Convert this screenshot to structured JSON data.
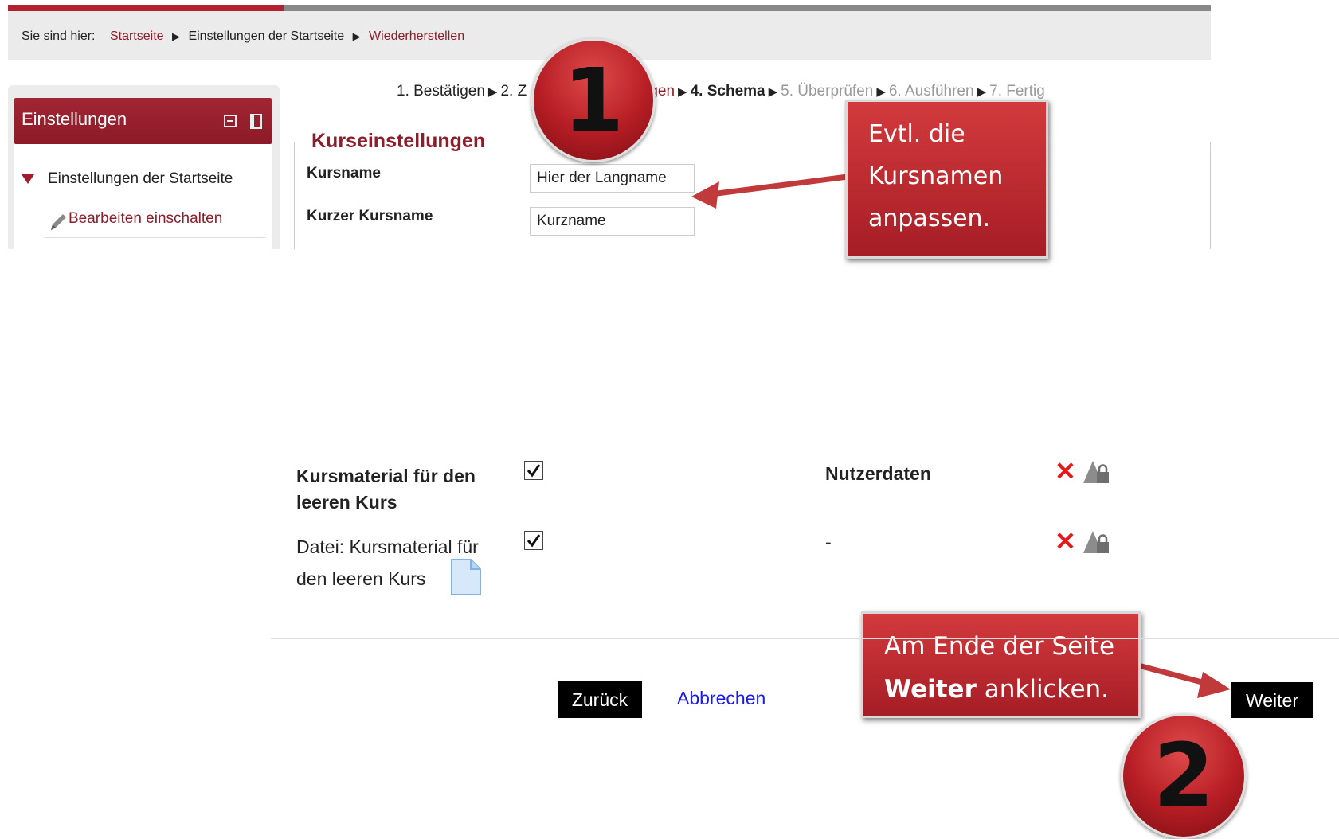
{
  "breadcrumb": {
    "lead": "Sie sind hier:",
    "items": [
      "Startseite",
      "Einstellungen der Startseite",
      "Wiederherstellen"
    ]
  },
  "sidebar": {
    "title": "Einstellungen",
    "items": [
      {
        "label": "Einstellungen der Startseite",
        "icon": "triangle-down-icon"
      },
      {
        "label": "Bearbeiten einschalten",
        "icon": "pencil-icon"
      }
    ]
  },
  "steps": {
    "s1": "1. Bestätigen",
    "s2": "2. Z",
    "s3": "ungen",
    "s4": "4. Schema",
    "s5": "5. Überprüfen",
    "s6": "6. Ausführen",
    "s7": "7. Fertig",
    "arrow": "▶"
  },
  "form": {
    "legend": "Kurseinstellungen",
    "fullname_label": "Kursname",
    "fullname_value": "Hier der Langname",
    "shortname_label": "Kurzer Kursname",
    "shortname_value": "Kurzname"
  },
  "callouts": {
    "c1": [
      "Evtl. die",
      "Kursnamen",
      "anpassen."
    ],
    "c2_line1": "Am Ende der Seite",
    "c2_bold": "Weiter",
    "c2_rest": " anklicken."
  },
  "badges": {
    "b1": "1",
    "b2": "2"
  },
  "schema": {
    "section_title": "Kursmaterial für den leeren Kurs",
    "section_userdata": "Nutzerdaten",
    "file_label": "Datei: Kursmaterial für den leeren Kurs",
    "file_userdata": "-"
  },
  "buttons": {
    "back": "Zurück",
    "cancel": "Abbrechen",
    "next": "Weiter"
  },
  "colors": {
    "brand": "#8a1e2a",
    "callout": "#b9262f",
    "link": "#1a1aee"
  }
}
